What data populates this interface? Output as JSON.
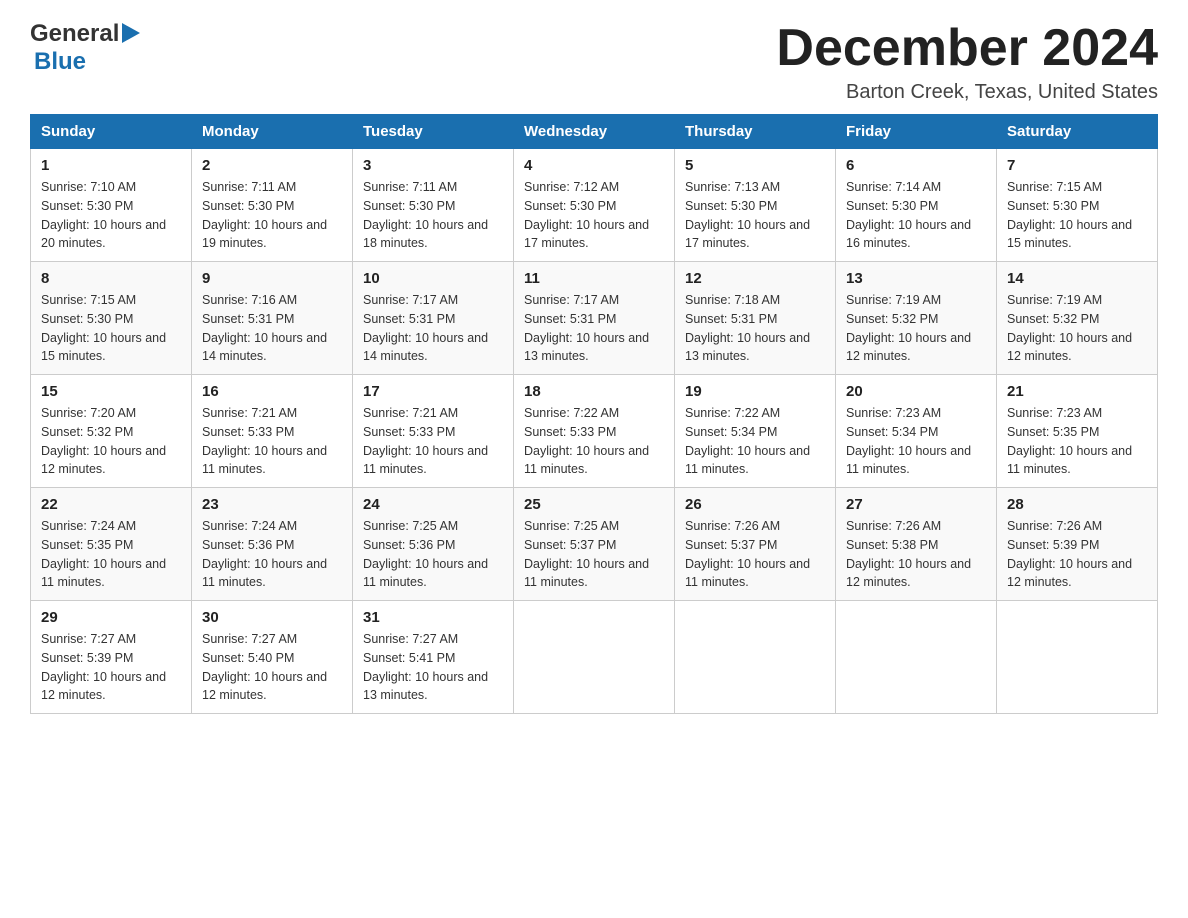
{
  "header": {
    "logo_general": "General",
    "logo_blue": "Blue",
    "month_title": "December 2024",
    "location": "Barton Creek, Texas, United States"
  },
  "weekdays": [
    "Sunday",
    "Monday",
    "Tuesday",
    "Wednesday",
    "Thursday",
    "Friday",
    "Saturday"
  ],
  "weeks": [
    [
      {
        "day": "1",
        "sunrise": "7:10 AM",
        "sunset": "5:30 PM",
        "daylight": "10 hours and 20 minutes."
      },
      {
        "day": "2",
        "sunrise": "7:11 AM",
        "sunset": "5:30 PM",
        "daylight": "10 hours and 19 minutes."
      },
      {
        "day": "3",
        "sunrise": "7:11 AM",
        "sunset": "5:30 PM",
        "daylight": "10 hours and 18 minutes."
      },
      {
        "day": "4",
        "sunrise": "7:12 AM",
        "sunset": "5:30 PM",
        "daylight": "10 hours and 17 minutes."
      },
      {
        "day": "5",
        "sunrise": "7:13 AM",
        "sunset": "5:30 PM",
        "daylight": "10 hours and 17 minutes."
      },
      {
        "day": "6",
        "sunrise": "7:14 AM",
        "sunset": "5:30 PM",
        "daylight": "10 hours and 16 minutes."
      },
      {
        "day": "7",
        "sunrise": "7:15 AM",
        "sunset": "5:30 PM",
        "daylight": "10 hours and 15 minutes."
      }
    ],
    [
      {
        "day": "8",
        "sunrise": "7:15 AM",
        "sunset": "5:30 PM",
        "daylight": "10 hours and 15 minutes."
      },
      {
        "day": "9",
        "sunrise": "7:16 AM",
        "sunset": "5:31 PM",
        "daylight": "10 hours and 14 minutes."
      },
      {
        "day": "10",
        "sunrise": "7:17 AM",
        "sunset": "5:31 PM",
        "daylight": "10 hours and 14 minutes."
      },
      {
        "day": "11",
        "sunrise": "7:17 AM",
        "sunset": "5:31 PM",
        "daylight": "10 hours and 13 minutes."
      },
      {
        "day": "12",
        "sunrise": "7:18 AM",
        "sunset": "5:31 PM",
        "daylight": "10 hours and 13 minutes."
      },
      {
        "day": "13",
        "sunrise": "7:19 AM",
        "sunset": "5:32 PM",
        "daylight": "10 hours and 12 minutes."
      },
      {
        "day": "14",
        "sunrise": "7:19 AM",
        "sunset": "5:32 PM",
        "daylight": "10 hours and 12 minutes."
      }
    ],
    [
      {
        "day": "15",
        "sunrise": "7:20 AM",
        "sunset": "5:32 PM",
        "daylight": "10 hours and 12 minutes."
      },
      {
        "day": "16",
        "sunrise": "7:21 AM",
        "sunset": "5:33 PM",
        "daylight": "10 hours and 11 minutes."
      },
      {
        "day": "17",
        "sunrise": "7:21 AM",
        "sunset": "5:33 PM",
        "daylight": "10 hours and 11 minutes."
      },
      {
        "day": "18",
        "sunrise": "7:22 AM",
        "sunset": "5:33 PM",
        "daylight": "10 hours and 11 minutes."
      },
      {
        "day": "19",
        "sunrise": "7:22 AM",
        "sunset": "5:34 PM",
        "daylight": "10 hours and 11 minutes."
      },
      {
        "day": "20",
        "sunrise": "7:23 AM",
        "sunset": "5:34 PM",
        "daylight": "10 hours and 11 minutes."
      },
      {
        "day": "21",
        "sunrise": "7:23 AM",
        "sunset": "5:35 PM",
        "daylight": "10 hours and 11 minutes."
      }
    ],
    [
      {
        "day": "22",
        "sunrise": "7:24 AM",
        "sunset": "5:35 PM",
        "daylight": "10 hours and 11 minutes."
      },
      {
        "day": "23",
        "sunrise": "7:24 AM",
        "sunset": "5:36 PM",
        "daylight": "10 hours and 11 minutes."
      },
      {
        "day": "24",
        "sunrise": "7:25 AM",
        "sunset": "5:36 PM",
        "daylight": "10 hours and 11 minutes."
      },
      {
        "day": "25",
        "sunrise": "7:25 AM",
        "sunset": "5:37 PM",
        "daylight": "10 hours and 11 minutes."
      },
      {
        "day": "26",
        "sunrise": "7:26 AM",
        "sunset": "5:37 PM",
        "daylight": "10 hours and 11 minutes."
      },
      {
        "day": "27",
        "sunrise": "7:26 AM",
        "sunset": "5:38 PM",
        "daylight": "10 hours and 12 minutes."
      },
      {
        "day": "28",
        "sunrise": "7:26 AM",
        "sunset": "5:39 PM",
        "daylight": "10 hours and 12 minutes."
      }
    ],
    [
      {
        "day": "29",
        "sunrise": "7:27 AM",
        "sunset": "5:39 PM",
        "daylight": "10 hours and 12 minutes."
      },
      {
        "day": "30",
        "sunrise": "7:27 AM",
        "sunset": "5:40 PM",
        "daylight": "10 hours and 12 minutes."
      },
      {
        "day": "31",
        "sunrise": "7:27 AM",
        "sunset": "5:41 PM",
        "daylight": "10 hours and 13 minutes."
      },
      null,
      null,
      null,
      null
    ]
  ],
  "labels": {
    "sunrise": "Sunrise:",
    "sunset": "Sunset:",
    "daylight": "Daylight:"
  }
}
